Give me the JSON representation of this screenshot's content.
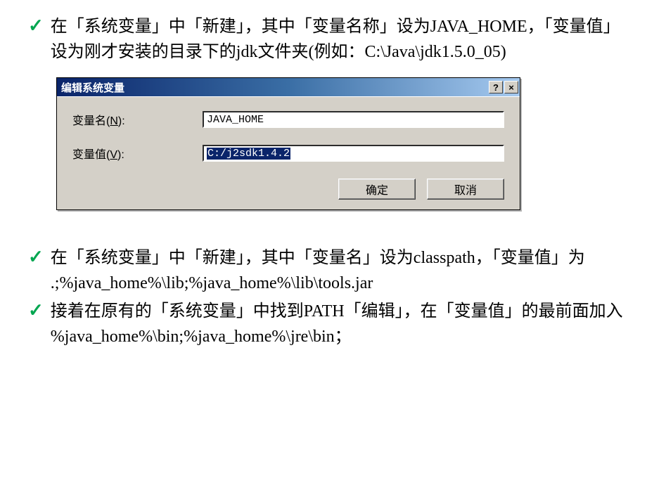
{
  "bullets": {
    "b1": "在「系统变量」中「新建」，其中「变量名称」设为JAVA_HOME，「变量值」设为刚才安装的目录下的jdk文件夹(例如：C:\\Java\\jdk1.5.0_05)",
    "b2": "在「系统变量」中「新建」，其中「变量名」设为classpath，「变量值」为",
    "b2_code": ".;%java_home%\\lib;%java_home%\\lib\\tools.jar",
    "b3": "接着在原有的「系统变量」中找到PATH「编辑」，在「变量值」的最前面加入",
    "b3_code": "%java_home%\\bin;%java_home%\\jre\\bin；"
  },
  "dialog": {
    "title": "编辑系统变量",
    "help_icon": "?",
    "close_icon": "×",
    "name_label_pre": "变量名(",
    "name_label_u": "N",
    "name_label_post": "):",
    "name_value": "JAVA_HOME",
    "value_label_pre": "变量值(",
    "value_label_u": "V",
    "value_label_post": "):",
    "value_value": "C:/j2sdk1.4.2",
    "ok": "确定",
    "cancel": "取消"
  },
  "check": "✓"
}
